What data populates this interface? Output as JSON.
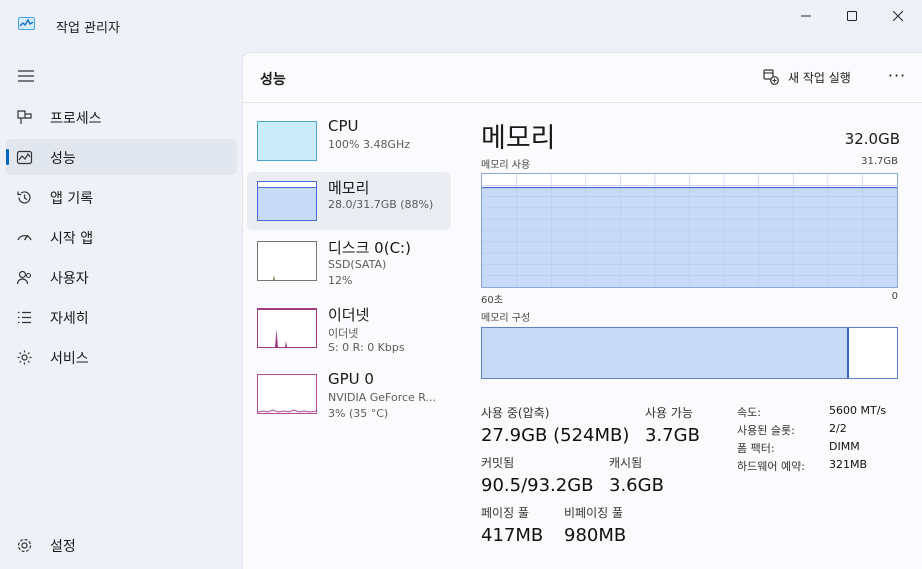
{
  "window": {
    "title": "작업 관리자",
    "controls": {
      "minimize": "minimize-icon",
      "maximize": "maximize-icon",
      "close": "close-icon"
    }
  },
  "nav": {
    "items": [
      {
        "label": "프로세스",
        "icon": "processes-icon"
      },
      {
        "label": "성능",
        "icon": "performance-icon",
        "active": true
      },
      {
        "label": "앱 기록",
        "icon": "history-icon"
      },
      {
        "label": "시작 앱",
        "icon": "startup-icon"
      },
      {
        "label": "사용자",
        "icon": "users-icon"
      },
      {
        "label": "자세히",
        "icon": "details-icon"
      },
      {
        "label": "서비스",
        "icon": "services-icon"
      }
    ],
    "settings_label": "설정"
  },
  "header": {
    "title": "성능",
    "new_task_label": "새 작업 실행",
    "more_label": "···"
  },
  "resources": [
    {
      "name": "CPU",
      "line1": "100% 3.48GHz",
      "line2": ""
    },
    {
      "name": "메모리",
      "line1": "28.0/31.7GB (88%)",
      "line2": "",
      "selected": true
    },
    {
      "name": "디스크 0(C:)",
      "line1": "SSD(SATA)",
      "line2": "12%"
    },
    {
      "name": "이더넷",
      "line1": "이더넷",
      "line2": "S: 0 R: 0 Kbps"
    },
    {
      "name": "GPU 0",
      "line1": "NVIDIA GeForce R...",
      "line2": "3% (35 °C)"
    }
  ],
  "detail": {
    "title": "메모리",
    "total": "32.0GB",
    "usage_label": "메모리 사용",
    "usage_max": "31.7GB",
    "axis_left": "60초",
    "axis_right": "0",
    "usage_level": 0.88,
    "composition_label": "메모리 구성",
    "composition_used": 0.884
  },
  "stats": {
    "in_use_label": "사용 중(압축)",
    "in_use_value": "27.9GB (524MB)",
    "available_label": "사용 가능",
    "available_value": "3.7GB",
    "committed_label": "커밋됨",
    "committed_value": "90.5/93.2GB",
    "cached_label": "캐시됨",
    "cached_value": "3.6GB",
    "paged_label": "페이징 풀",
    "paged_value": "417MB",
    "nonpaged_label": "비페이징 풀",
    "nonpaged_value": "980MB"
  },
  "props": [
    {
      "label": "속도:",
      "value": "5600 MT/s"
    },
    {
      "label": "사용된 슬롯:",
      "value": "2/2"
    },
    {
      "label": "폼 팩터:",
      "value": "DIMM"
    },
    {
      "label": "하드웨어 예약:",
      "value": "321MB"
    }
  ],
  "colors": {
    "accent": "#0067c0",
    "cpu": "#117dbb",
    "memory": "#4c6ad8",
    "memory_fill": "#c7daf7",
    "ethernet": "#a23d84",
    "gpu": "#b34c9c"
  }
}
